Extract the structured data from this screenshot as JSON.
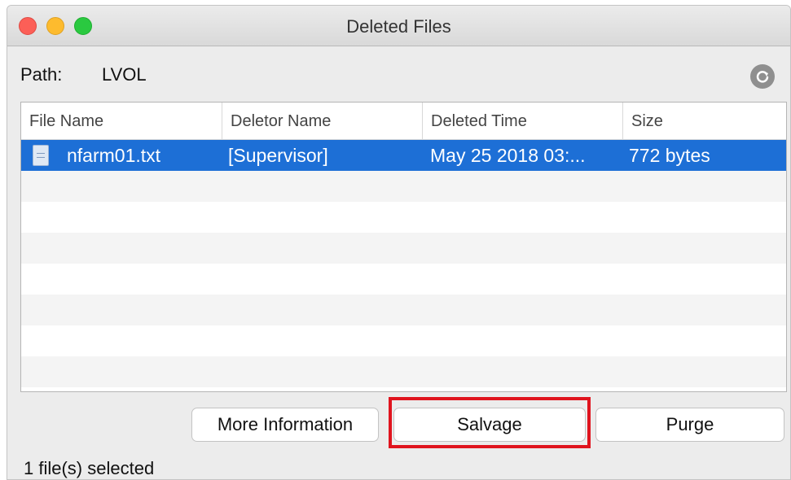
{
  "window": {
    "title": "Deleted Files"
  },
  "path": {
    "label": "Path:",
    "value": "LVOL",
    "refresh_icon": "refresh-icon"
  },
  "table": {
    "columns": [
      "File Name",
      "Deletor Name",
      "Deleted Time",
      "Size"
    ],
    "rows": [
      {
        "file_name": "nfarm01.txt",
        "deletor_name": "[Supervisor]",
        "deleted_time": "May 25 2018 03:...",
        "size": "772 bytes",
        "selected": true,
        "icon": "text-file-icon"
      }
    ]
  },
  "buttons": {
    "more_info": "More Information",
    "salvage": "Salvage",
    "purge": "Purge"
  },
  "status": {
    "text": "1 file(s) selected"
  },
  "colors": {
    "selection": "#1d6fd6",
    "highlight_box": "#e0141e",
    "close": "#fc5f57",
    "minimize": "#fdbb2e",
    "maximize": "#2ac940"
  }
}
